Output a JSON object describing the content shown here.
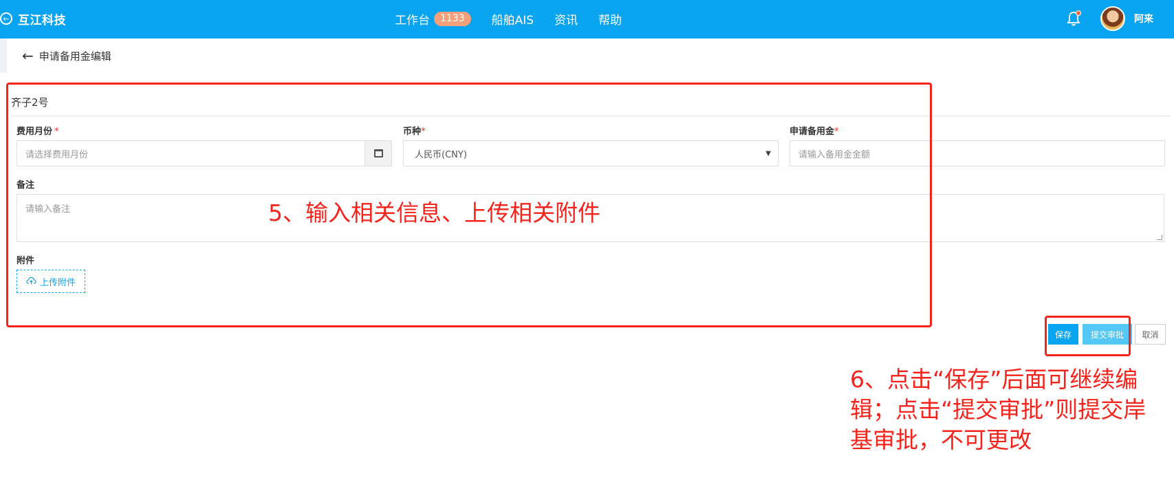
{
  "topbar": {
    "brand_icon": "back-circle-icon",
    "brand_name": "互江科技",
    "nav": [
      {
        "label": "工作台",
        "badge": "1133"
      },
      {
        "label": "船舶AIS"
      },
      {
        "label": "资讯"
      },
      {
        "label": "帮助"
      }
    ],
    "username": "阿来"
  },
  "page": {
    "title": "申请备用金编辑"
  },
  "form": {
    "vessel_name": "齐子2号",
    "month_label": "费用月份",
    "month_placeholder": "请选择费用月份",
    "currency_label": "币种",
    "currency_value": "人民币(CNY)",
    "amount_label": "申请备用金",
    "amount_placeholder": "请输入备用金金额",
    "remark_label": "备注",
    "remark_placeholder": "请输入备注",
    "attachment_label": "附件",
    "upload_label": "上传附件",
    "required_mark": "*"
  },
  "actions": {
    "save_label": "保存",
    "submit_label": "提交审批",
    "cancel_label": "取消"
  },
  "annotations": {
    "step5": "5、输入相关信息、上传相关附件",
    "step6_line1": "6、点击“保存”后面可继续编",
    "step6_line2": "辑；点击“提交审批”则提交岸",
    "step6_line3": "基审批，不可更改"
  },
  "colors": {
    "primary": "#08a4f0",
    "annotation": "#f4241d",
    "badge": "#f4a07a",
    "required": "#e8322e"
  }
}
